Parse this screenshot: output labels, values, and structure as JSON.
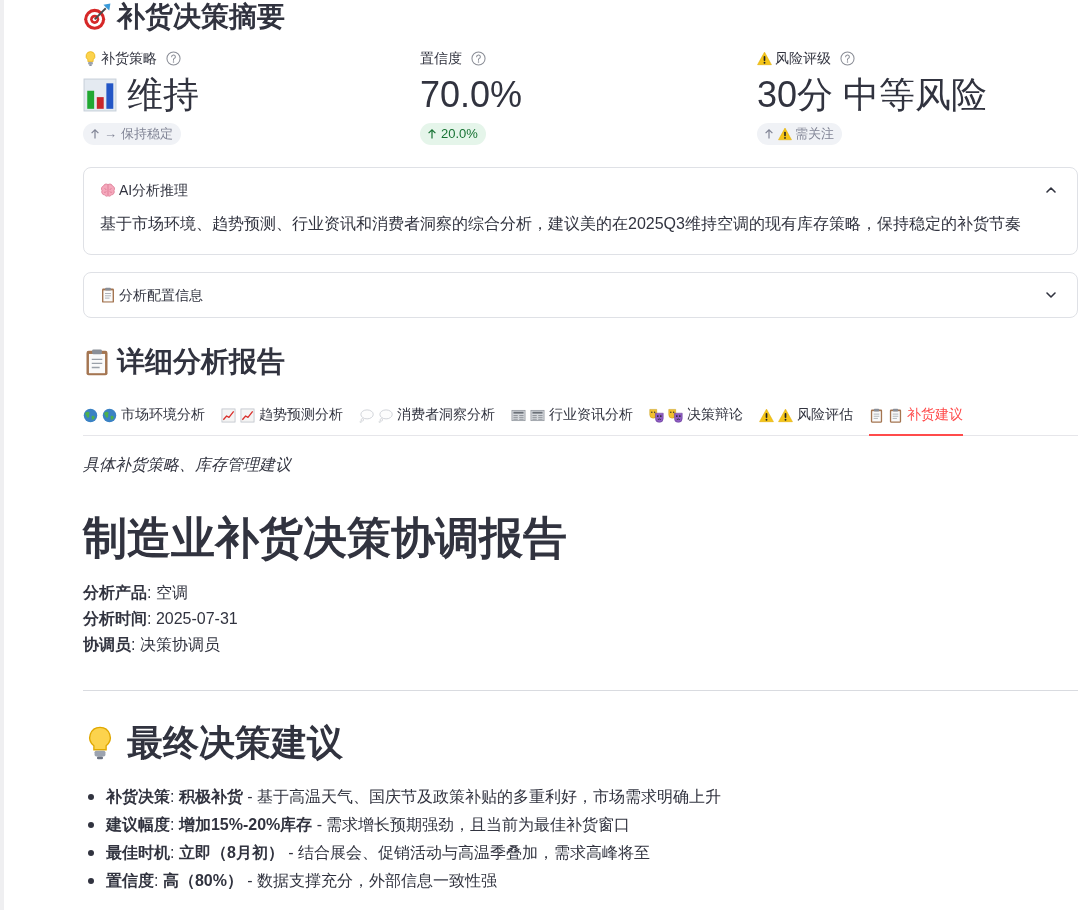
{
  "summary": {
    "title": "补货决策摘要",
    "metrics": [
      {
        "label": "补货策略",
        "value": "维持",
        "delta": "→ 保持稳定",
        "muted": true
      },
      {
        "label": "置信度",
        "value": "70.0%",
        "delta": "20.0%",
        "muted": false
      },
      {
        "label": "风险评级",
        "value": "30分 中等风险",
        "delta": "需关注",
        "muted": true
      }
    ]
  },
  "expanders": [
    {
      "title": "AI分析推理",
      "expanded": true,
      "body": "基于市场环境、趋势预测、行业资讯和消费者洞察的综合分析，建议美的在2025Q3维持空调的现有库存策略，保持稳定的补货节奏"
    },
    {
      "title": "分析配置信息",
      "expanded": false
    }
  ],
  "report": {
    "title": "详细分析报告",
    "tabs": [
      {
        "label": "市场环境分析",
        "selected": false
      },
      {
        "label": "趋势预测分析",
        "selected": false
      },
      {
        "label": "消费者洞察分析",
        "selected": false
      },
      {
        "label": "行业资讯分析",
        "selected": false
      },
      {
        "label": "决策辩论",
        "selected": false
      },
      {
        "label": "风险评估",
        "selected": false
      },
      {
        "label": "补货建议",
        "selected": true
      }
    ],
    "caption": "具体补货策略、库存管理建议",
    "heading": "制造业补货决策协调报告",
    "meta": [
      "**分析产品**: 空调",
      "**分析时间**: 2025-07-31",
      "**协调员**: 决策协调员"
    ],
    "section_title": "最终决策建议",
    "bullets": [
      "**补货决策**: **积极补货** - 基于高温天气、国庆节及政策补贴的多重利好，市场需求明确上升",
      "**建议幅度**: **增加15%-20%库存** - 需求增长预期强劲，且当前为最佳补货窗口",
      "**最佳时机**: **立即（8月初）** - 结合展会、促销活动与高温季叠加，需求高峰将至",
      "**置信度**: **高（80%）** - 数据支撑充分，外部信息一致性强"
    ]
  }
}
